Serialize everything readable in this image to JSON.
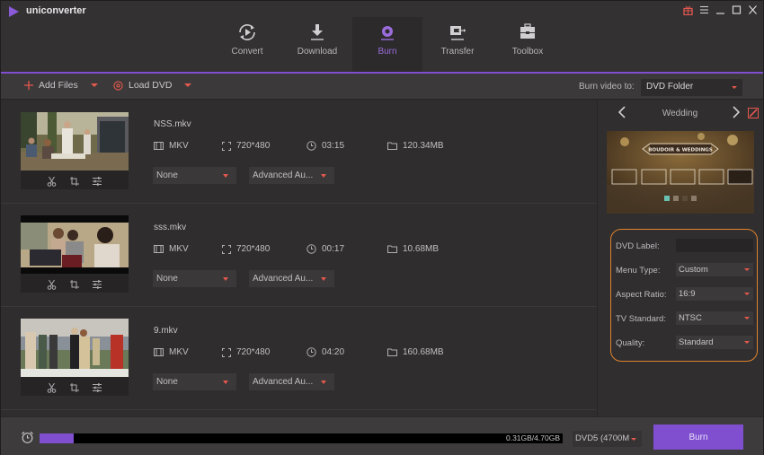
{
  "app": {
    "name": "uniconverter",
    "window_controls": [
      "gift-icon",
      "menu-icon",
      "minimize-icon",
      "maximize-icon",
      "close-icon"
    ]
  },
  "nav": {
    "tabs": [
      {
        "label": "Convert",
        "icon": "convert-icon",
        "active": false
      },
      {
        "label": "Download",
        "icon": "download-icon",
        "active": false
      },
      {
        "label": "Burn",
        "icon": "disc-icon",
        "active": true
      },
      {
        "label": "Transfer",
        "icon": "transfer-icon",
        "active": false
      },
      {
        "label": "Toolbox",
        "icon": "toolbox-icon",
        "active": false
      }
    ]
  },
  "toolbar": {
    "add_files": "Add Files",
    "load_dvd": "Load DVD",
    "burn_to_label": "Burn video to:",
    "burn_to_value": "DVD Folder"
  },
  "files": [
    {
      "name": "NSS.mkv",
      "format": "MKV",
      "resolution": "720*480",
      "duration": "03:15",
      "size": "120.34MB",
      "subtitle": "None",
      "audio": "Advanced Au..."
    },
    {
      "name": "sss.mkv",
      "format": "MKV",
      "resolution": "720*480",
      "duration": "00:17",
      "size": "10.68MB",
      "subtitle": "None",
      "audio": "Advanced Au..."
    },
    {
      "name": "9.mkv",
      "format": "MKV",
      "resolution": "720*480",
      "duration": "04:20",
      "size": "160.68MB",
      "subtitle": "None",
      "audio": "Advanced Au..."
    }
  ],
  "template": {
    "name": "Wedding",
    "preview_title": "BOUDOIR & WEDDINGS"
  },
  "settings": {
    "dvd_label": {
      "label": "DVD Label:",
      "value": ""
    },
    "menu_type": {
      "label": "Menu Type:",
      "value": "Custom"
    },
    "aspect_ratio": {
      "label": "Aspect Ratio:",
      "value": "16:9"
    },
    "tv_standard": {
      "label": "TV Standard:",
      "value": "NTSC"
    },
    "quality": {
      "label": "Quality:",
      "value": "Standard"
    }
  },
  "bottom": {
    "usage_text": "0.31GB/4.70GB",
    "usage_fraction": 0.066,
    "disc_type": "DVD5 (4700M",
    "burn_button": "Burn"
  },
  "colors": {
    "accent": "#7f4fd0",
    "caret": "#e5584d",
    "highlight": "#e0832f"
  }
}
